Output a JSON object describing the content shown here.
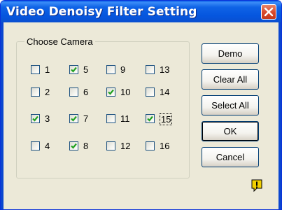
{
  "window": {
    "title": "Video Denoisy Filter Setting"
  },
  "group": {
    "title": "Choose Camera",
    "cameras": [
      {
        "label": "1",
        "checked": false
      },
      {
        "label": "2",
        "checked": false
      },
      {
        "label": "3",
        "checked": true
      },
      {
        "label": "4",
        "checked": false
      },
      {
        "label": "5",
        "checked": true
      },
      {
        "label": "6",
        "checked": false
      },
      {
        "label": "7",
        "checked": true
      },
      {
        "label": "8",
        "checked": true
      },
      {
        "label": "9",
        "checked": false
      },
      {
        "label": "10",
        "checked": true
      },
      {
        "label": "11",
        "checked": false
      },
      {
        "label": "12",
        "checked": false
      },
      {
        "label": "13",
        "checked": false
      },
      {
        "label": "14",
        "checked": false
      },
      {
        "label": "15",
        "checked": true
      },
      {
        "label": "16",
        "checked": false
      }
    ]
  },
  "buttons": {
    "demo": "Demo",
    "clear_all": "Clear All",
    "select_all": "Select All",
    "ok": "OK",
    "cancel": "Cancel"
  },
  "icons": {
    "status": "warning-icon",
    "close": "close-icon"
  },
  "colors": {
    "titlebar": "#0556de",
    "close": "#d8472a",
    "checkmark": "#21a121",
    "warning": "#f2d000"
  }
}
